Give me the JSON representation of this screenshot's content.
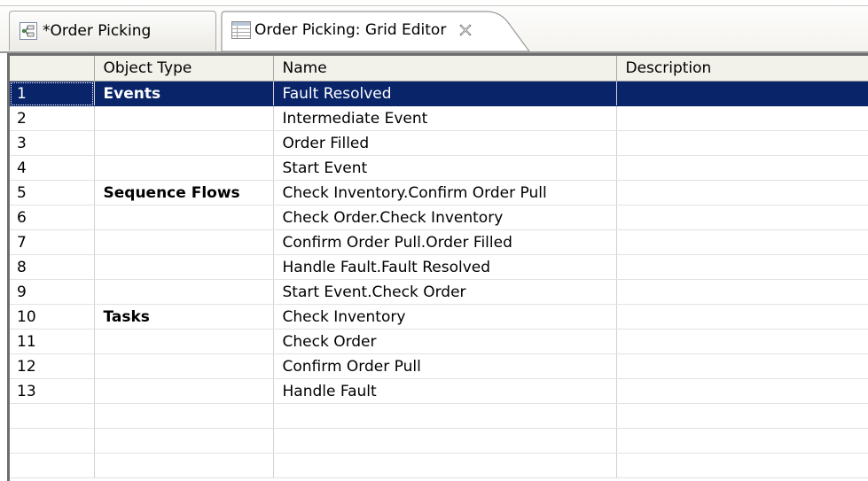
{
  "tabs": [
    {
      "label": "*Order Picking",
      "icon": "process-diagram-icon"
    },
    {
      "label": "Order Picking: Grid Editor",
      "icon": "grid-table-icon",
      "close_icon": "close-icon"
    }
  ],
  "grid": {
    "columns": [
      "",
      "Object Type",
      "Name",
      "Description"
    ],
    "rows": [
      {
        "num": "1",
        "type": "Events",
        "name": "Fault Resolved",
        "description": ""
      },
      {
        "num": "2",
        "type": "",
        "name": "Intermediate Event",
        "description": ""
      },
      {
        "num": "3",
        "type": "",
        "name": "Order Filled",
        "description": ""
      },
      {
        "num": "4",
        "type": "",
        "name": "Start Event",
        "description": ""
      },
      {
        "num": "5",
        "type": "Sequence Flows",
        "name": "Check Inventory.Confirm Order Pull",
        "description": ""
      },
      {
        "num": "6",
        "type": "",
        "name": "Check Order.Check Inventory",
        "description": ""
      },
      {
        "num": "7",
        "type": "",
        "name": "Confirm Order Pull.Order Filled",
        "description": ""
      },
      {
        "num": "8",
        "type": "",
        "name": "Handle Fault.Fault Resolved",
        "description": ""
      },
      {
        "num": "9",
        "type": "",
        "name": "Start Event.Check Order",
        "description": ""
      },
      {
        "num": "10",
        "type": "Tasks",
        "name": "Check Inventory",
        "description": ""
      },
      {
        "num": "11",
        "type": "",
        "name": "Check Order",
        "description": ""
      },
      {
        "num": "12",
        "type": "",
        "name": "Confirm Order Pull",
        "description": ""
      },
      {
        "num": "13",
        "type": "",
        "name": "Handle Fault",
        "description": ""
      }
    ],
    "empty_rows": 3,
    "selected_row": 0,
    "selection_color": "#0a246a"
  }
}
